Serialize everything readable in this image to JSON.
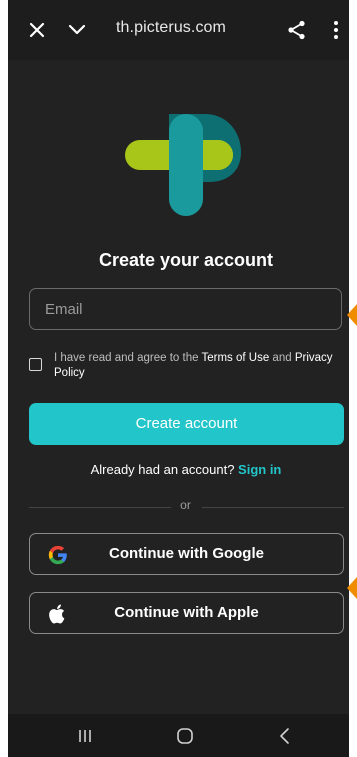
{
  "browser": {
    "url": "th.picterus.com"
  },
  "signup": {
    "title": "Create your account",
    "email_placeholder": "Email",
    "agree_prefix": "I have read and agree to the ",
    "terms_link": "Terms of Use",
    "agree_and": " and ",
    "privacy_link": "Privacy Policy",
    "create_button": "Create account",
    "have_account": "Already had an account?",
    "sign_in": "Sign in",
    "divider_text": "or",
    "google_button": "Continue with Google",
    "apple_button": "Continue with Apple"
  },
  "colors": {
    "accent": "#22c5c9",
    "background": "#222222",
    "logo_teal": "#1a9a9c",
    "logo_lime": "#a8c61a",
    "side_marker": "#f08c00"
  },
  "icons": [
    "close-icon",
    "chevron-down-icon",
    "share-icon",
    "more-vert-icon",
    "google-icon",
    "apple-icon",
    "recent-apps-icon",
    "home-icon",
    "back-icon"
  ]
}
